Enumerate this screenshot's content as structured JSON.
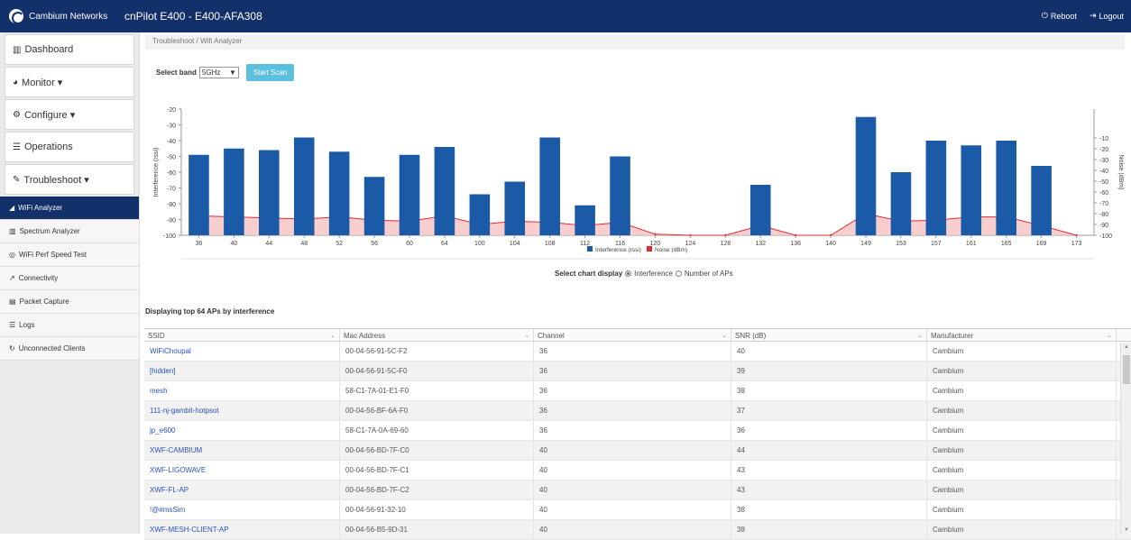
{
  "header": {
    "brand": "Cambium Networks",
    "title": "cnPilot E400 - E400-AFA308",
    "reboot": "Reboot",
    "logout": "Logout",
    "bg_color": "#12306a"
  },
  "sidebar": {
    "main_items": [
      {
        "label": "Dashboard",
        "icon": "bar-chart-icon"
      },
      {
        "label": "Monitor ▾",
        "icon": "dashboard-icon"
      },
      {
        "label": "Configure ▾",
        "icon": "gear-icon"
      },
      {
        "label": "Operations",
        "icon": "sliders-icon"
      },
      {
        "label": "Troubleshoot ▾",
        "icon": "wrench-icon"
      }
    ],
    "sub_items": [
      {
        "label": "WiFi Analyzer",
        "icon": "signal-icon",
        "active": true
      },
      {
        "label": "Spectrum Analyzer",
        "icon": "bar-chart-icon",
        "active": false
      },
      {
        "label": "WiFi Perf Speed Test",
        "icon": "speedometer-icon",
        "active": false
      },
      {
        "label": "Connectivity",
        "icon": "external-link-icon",
        "active": false
      },
      {
        "label": "Packet Capture",
        "icon": "hdd-icon",
        "active": false
      },
      {
        "label": "Logs",
        "icon": "list-icon",
        "active": false
      },
      {
        "label": "Unconnected Clients",
        "icon": "refresh-icon",
        "active": false
      }
    ]
  },
  "breadcrumb": "Troubleshoot / Wifi Analyzer",
  "band": {
    "label": "Select band",
    "value": "5GHz",
    "scan_button": "Start Scan"
  },
  "chart_display": {
    "label": "Select chart display",
    "option1": "Interference",
    "option2": "Number of APs",
    "selected": "Interference"
  },
  "table": {
    "title": "Displaying top 64 APs by interference",
    "columns": [
      "SSID",
      "Mac Address",
      "Channel",
      "SNR (dB)",
      "Manufacturer"
    ],
    "rows": [
      [
        "WiFiChoupal",
        "00-04-56-91-5C-F2",
        "36",
        "40",
        "Cambium"
      ],
      [
        "[hidden]",
        "00-04-56-91-5C-F0",
        "36",
        "39",
        "Cambium"
      ],
      [
        "mesh",
        "58-C1-7A-01-E1-F0",
        "36",
        "38",
        "Cambium"
      ],
      [
        "111-nj-gambit-hotpsot",
        "00-04-56-BF-6A-F0",
        "36",
        "37",
        "Cambium"
      ],
      [
        "jp_e600",
        "58-C1-7A-0A-69-60",
        "36",
        "36",
        "Cambium"
      ],
      [
        "XWF-CAMBIUM",
        "00-04-56-BD-7F-C0",
        "40",
        "44",
        "Cambium"
      ],
      [
        "XWF-LIGOWAVE",
        "00-04-56-BD-7F-C1",
        "40",
        "43",
        "Cambium"
      ],
      [
        "XWF-FL-AP",
        "00-04-56-BD-7F-C2",
        "40",
        "43",
        "Cambium"
      ],
      [
        "!@#msSim",
        "00-04-56-91-32-10",
        "40",
        "38",
        "Cambium"
      ],
      [
        "XWF-MESH-CLIENT-AP",
        "00-04-56-B5-9D-31",
        "40",
        "38",
        "Cambium"
      ]
    ]
  },
  "chart_data": {
    "type": "bar",
    "categories": [
      "36",
      "40",
      "44",
      "48",
      "52",
      "56",
      "60",
      "64",
      "100",
      "104",
      "108",
      "112",
      "116",
      "120",
      "124",
      "128",
      "132",
      "136",
      "140",
      "149",
      "153",
      "157",
      "161",
      "165",
      "169",
      "173"
    ],
    "series": [
      {
        "name": "Interference (rssi)",
        "color": "#1a5aa6",
        "values": [
          -49,
          -45,
          -46,
          -38,
          -47,
          -63,
          -49,
          -44,
          -74,
          -66,
          -38,
          -81,
          -50,
          null,
          null,
          null,
          -68,
          null,
          null,
          -25,
          -60,
          -40,
          -43,
          -40,
          -56,
          null
        ]
      },
      {
        "name": "Noise (dBm)",
        "color": "#e8262c",
        "values": [
          -82,
          -83,
          -84,
          -85,
          -83,
          -86,
          -87,
          -82,
          -90,
          -87,
          -88,
          -91,
          -88,
          -99,
          -100,
          -100,
          -91,
          -100,
          -100,
          -80,
          -87,
          -86,
          -83,
          -83,
          -91,
          -100
        ]
      }
    ],
    "ylabel": "Interference (rssi)",
    "y2label": "Noise (dBm)",
    "ylim": [
      -100,
      -20
    ],
    "y2lim": [
      -100,
      0
    ],
    "yticks": [
      "-20",
      "-30",
      "-40",
      "-50",
      "-60",
      "-70",
      "-80",
      "-90",
      "-100"
    ],
    "y2ticks": [
      "-10",
      "-20",
      "-30",
      "-40",
      "-50",
      "-60",
      "-70",
      "-80",
      "-90",
      "-100"
    ],
    "legend": "bottom-center"
  }
}
